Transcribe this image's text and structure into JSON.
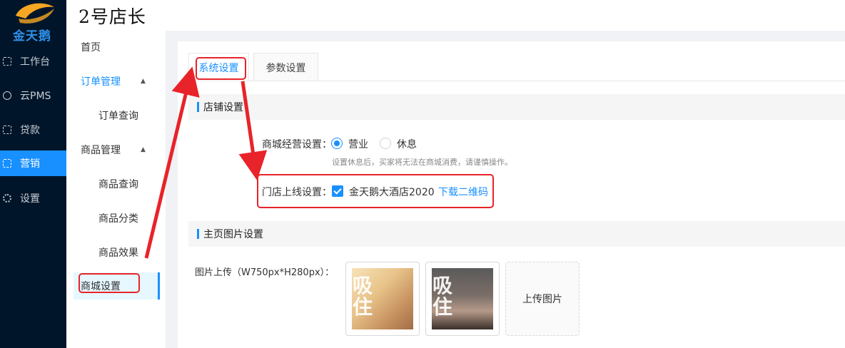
{
  "brand": {
    "logo_text": "金天鹅"
  },
  "header": {
    "store_title": "2号店长"
  },
  "nav": [
    {
      "label": "工作台",
      "icon": "workbench-icon"
    },
    {
      "label": "云PMS",
      "icon": "cloud-icon"
    },
    {
      "label": "贷款",
      "icon": "loan-icon"
    },
    {
      "label": "营销",
      "icon": "marketing-icon",
      "active": true
    },
    {
      "label": "设置",
      "icon": "gear-icon"
    }
  ],
  "subnav": {
    "home": "首页",
    "order_mgmt": "订单管理",
    "order_query": "订单查询",
    "goods_mgmt": "商品管理",
    "goods_query": "商品查询",
    "goods_category": "商品分类",
    "goods_effect": "商品效果",
    "mall_settings": "商城设置"
  },
  "tabs": [
    {
      "label": "系统设置",
      "active": true
    },
    {
      "label": "参数设置",
      "active": false
    }
  ],
  "store_section": {
    "title": "店铺设置",
    "mall_operation_label": "商城经营设置：",
    "option_open": "营业",
    "option_rest": "休息",
    "selected": "营业",
    "hint": "设置休息后，买家将无法在商城消费，请谨慎操作。",
    "store_online_label": "门店上线设置：",
    "store_name": "金天鹅大酒店2020",
    "store_checked": true,
    "download_qr": "下载二维码"
  },
  "homepage_section": {
    "title": "主页图片设置",
    "upload_label": "图片上传（W750px*H280px）：",
    "upload_button": "上传图片",
    "images": [
      {
        "glyphs": "吸住"
      },
      {
        "glyphs": "吸住"
      }
    ]
  },
  "colors": {
    "accent": "#1890ff",
    "nav_bg": "#001529",
    "annotation": "#e8232a"
  }
}
